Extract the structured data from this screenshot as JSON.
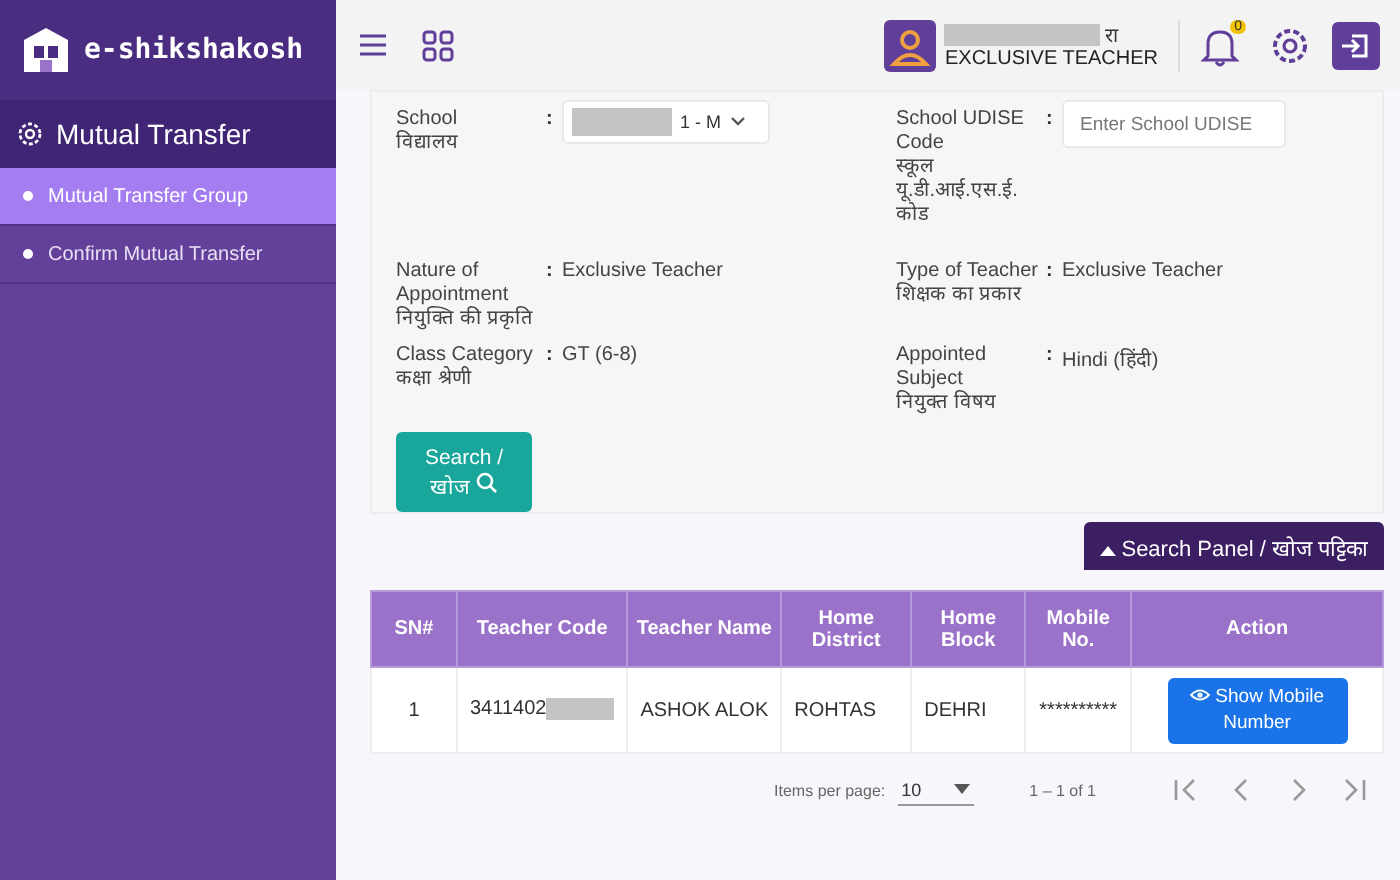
{
  "header": {
    "logo_text": "e-shikshakosh",
    "user": {
      "name_suffix": "रा",
      "role": "EXCLUSIVE TEACHER"
    },
    "notification_count": "0"
  },
  "sidebar": {
    "title": "Mutual Transfer",
    "items": [
      {
        "label": "Mutual Transfer Group",
        "selected": true
      },
      {
        "label": "Confirm Mutual Transfer",
        "selected": false
      }
    ]
  },
  "form": {
    "separator": ":",
    "fields": [
      {
        "kind": "select",
        "label": "School",
        "label_hi": "विद्यालय",
        "value": "1 - M"
      },
      {
        "kind": "input",
        "label": "School UDISE Code",
        "label_hi": "स्कूल यू.डी.आई.एस.ई. कोड",
        "placeholder": "Enter School UDISE"
      },
      {
        "kind": "text",
        "label": "Nature of Appointment",
        "label_hi": "नियुक्ति की प्रकृति",
        "value": "Exclusive Teacher"
      },
      {
        "kind": "text",
        "label": "Type of Teacher",
        "label_hi": "शिक्षक का प्रकार",
        "value": "Exclusive Teacher"
      },
      {
        "kind": "text",
        "label": "Class Category",
        "label_hi": "कक्षा श्रेणी",
        "value": "GT (6-8)"
      },
      {
        "kind": "text",
        "label": "Appointed Subject",
        "label_hi": "नियुक्त विषय",
        "value": "Hindi (हिंदी)"
      }
    ],
    "search_button": "Search / खोज"
  },
  "panel_toggle": "Search Panel / खोज पट्टिका",
  "table": {
    "columns": [
      "SN#",
      "Teacher Code",
      "Teacher Name",
      "Home District",
      "Home Block",
      "Mobile No.",
      "Action"
    ],
    "rows": [
      {
        "sn": "1",
        "teacher_code": "3411402",
        "teacher_name": "ASHOK ALOK",
        "home_district": "ROHTAS",
        "home_block": "DEHRI",
        "mobile": "**********",
        "action": "Show Mobile Number"
      }
    ]
  },
  "pagination": {
    "label": "Items per page:",
    "page_size": "10",
    "range": "1 – 1 of 1"
  }
}
